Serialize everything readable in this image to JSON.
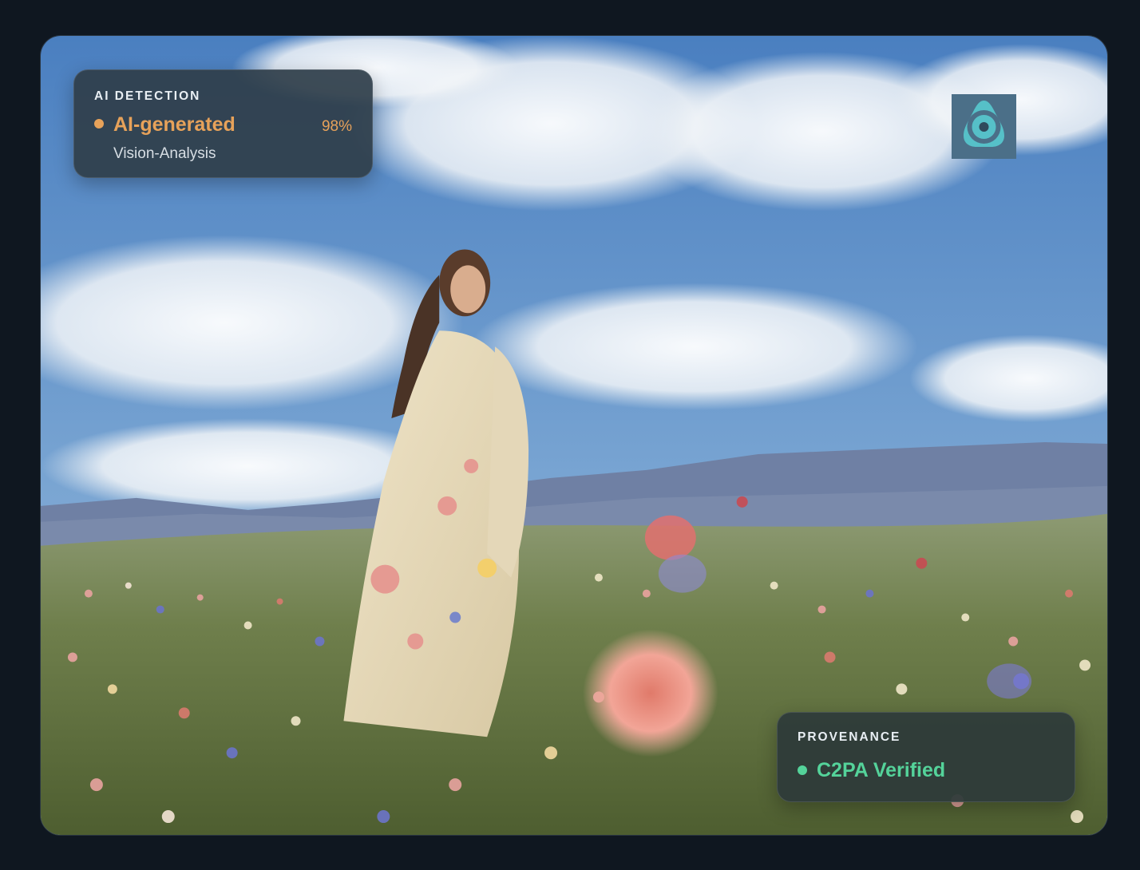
{
  "image": {
    "alt_subject": "woman-in-flower-field"
  },
  "ai_detection": {
    "heading": "AI DETECTION",
    "verdict": "AI-generated",
    "score": "98%",
    "method": "Vision-Analysis",
    "accent_color": "#e7a25a"
  },
  "provenance": {
    "heading": "PROVENANCE",
    "status": "C2PA Verified",
    "accent_color": "#54d39a"
  },
  "logo": {
    "icon": "eye-triangle-logo-icon"
  }
}
